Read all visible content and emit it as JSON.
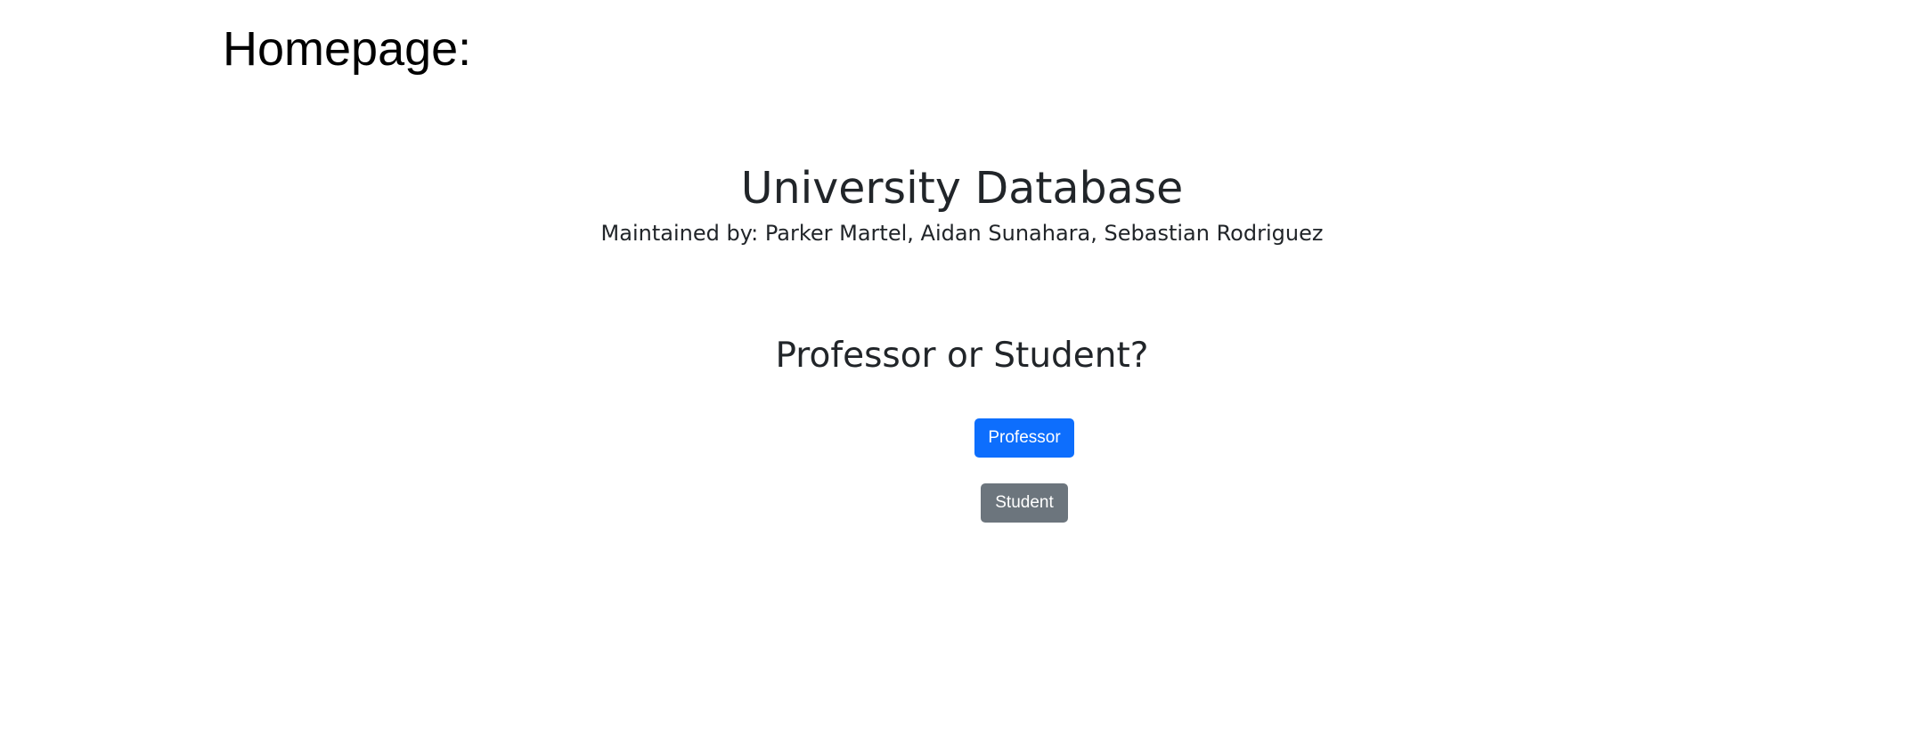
{
  "caption": "Homepage:",
  "page": {
    "title": "University Database",
    "maintainers": "Maintained by: Parker Martel, Aidan Sunahara, Sebastian Rodriguez",
    "prompt": "Professor or Student?"
  },
  "buttons": {
    "professor_label": "Professor",
    "student_label": "Student"
  },
  "colors": {
    "primary": "#0d6efd",
    "secondary": "#6c757d",
    "text": "#212529"
  }
}
